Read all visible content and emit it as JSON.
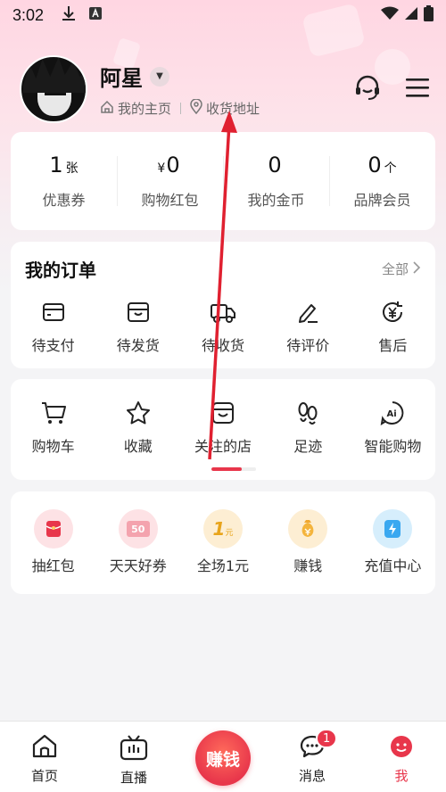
{
  "status_bar": {
    "time": "3:02"
  },
  "profile": {
    "name": "阿星",
    "home_link": "我的主页",
    "address_link": "收货地址"
  },
  "stats": [
    {
      "value": "1",
      "prefix": "",
      "unit": "张",
      "label": "优惠券"
    },
    {
      "value": "0",
      "prefix": "¥",
      "unit": "",
      "label": "购物红包"
    },
    {
      "value": "0",
      "prefix": "",
      "unit": "",
      "label": "我的金币"
    },
    {
      "value": "0",
      "prefix": "",
      "unit": "个",
      "label": "品牌会员"
    }
  ],
  "orders": {
    "title": "我的订单",
    "all_label": "全部",
    "items": [
      {
        "label": "待支付",
        "icon": "wallet-icon"
      },
      {
        "label": "待发货",
        "icon": "package-icon"
      },
      {
        "label": "待收货",
        "icon": "truck-icon"
      },
      {
        "label": "待评价",
        "icon": "pencil-icon"
      },
      {
        "label": "售后",
        "icon": "refund-icon"
      }
    ]
  },
  "tools": {
    "items": [
      {
        "label": "购物车",
        "icon": "cart-icon"
      },
      {
        "label": "收藏",
        "icon": "star-icon"
      },
      {
        "label": "关注的店",
        "icon": "store-icon"
      },
      {
        "label": "足迹",
        "icon": "footprints-icon"
      },
      {
        "label": "智能购物",
        "icon": "ai-icon"
      }
    ],
    "scroll_progress": 0.68
  },
  "promos": {
    "items": [
      {
        "label": "抽红包",
        "icon": "red-envelope-icon",
        "badge": ""
      },
      {
        "label": "天天好券",
        "icon": "coupon-icon",
        "badge": "50"
      },
      {
        "label": "全场1元",
        "icon": "one-yuan-icon",
        "badge": "1",
        "badge_unit": "元"
      },
      {
        "label": "赚钱",
        "icon": "money-bag-icon",
        "badge": ""
      },
      {
        "label": "充值中心",
        "icon": "lightning-icon",
        "badge": ""
      }
    ]
  },
  "bottom_nav": {
    "items": [
      {
        "label": "首页",
        "icon": "home-icon"
      },
      {
        "label": "直播",
        "icon": "tv-icon"
      },
      {
        "label": "赚钱",
        "icon": "earn-button"
      },
      {
        "label": "消息",
        "icon": "chat-icon",
        "badge": "1"
      },
      {
        "label": "我",
        "icon": "me-icon",
        "active": true
      }
    ]
  },
  "colors": {
    "accent": "#e8364b",
    "background": "#f4f4f6",
    "hero_pink": "#ffd6e2"
  }
}
